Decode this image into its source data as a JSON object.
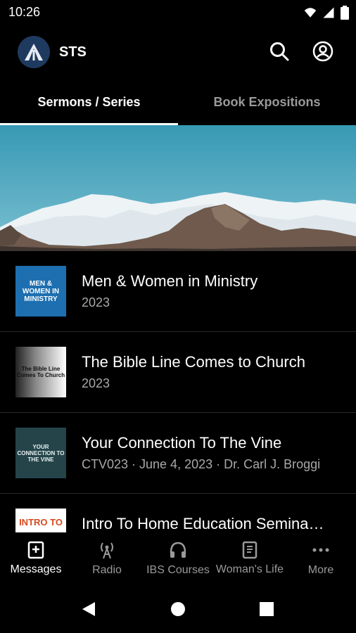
{
  "status": {
    "time": "10:26"
  },
  "app": {
    "title": "STS"
  },
  "tabs": [
    {
      "label": "Sermons / Series",
      "active": true
    },
    {
      "label": "Book Expositions",
      "active": false
    }
  ],
  "items": [
    {
      "title": "Men & Women in Ministry",
      "subtitle": "2023",
      "thumb_text": "MEN & WOMEN IN MINISTRY"
    },
    {
      "title": "The Bible Line Comes to Church",
      "subtitle": "2023",
      "thumb_text": "The Bible Line Comes To Church"
    },
    {
      "title": "Your Connection To The Vine",
      "subtitle": "CTV023 · June 4, 2023 · Dr. Carl J. Broggi",
      "thumb_text": "YOUR CONNECTION TO THE VINE"
    },
    {
      "title": "Intro To Home Education Semina…",
      "subtitle": "",
      "thumb_text": "INTRO TO"
    }
  ],
  "nav": [
    {
      "label": "Messages",
      "icon": "book-plus-icon",
      "active": true
    },
    {
      "label": "Radio",
      "icon": "radio-tower-icon",
      "active": false
    },
    {
      "label": "IBS Courses",
      "icon": "headphones-icon",
      "active": false
    },
    {
      "label": "Woman's Life",
      "icon": "book-open-icon",
      "active": false
    },
    {
      "label": "More",
      "icon": "more-dots-icon",
      "active": false
    }
  ],
  "colors": {
    "background": "#000000",
    "accent": "#ffffff",
    "muted": "#9a9a9a",
    "logo_bg": "#1f3a5f"
  }
}
